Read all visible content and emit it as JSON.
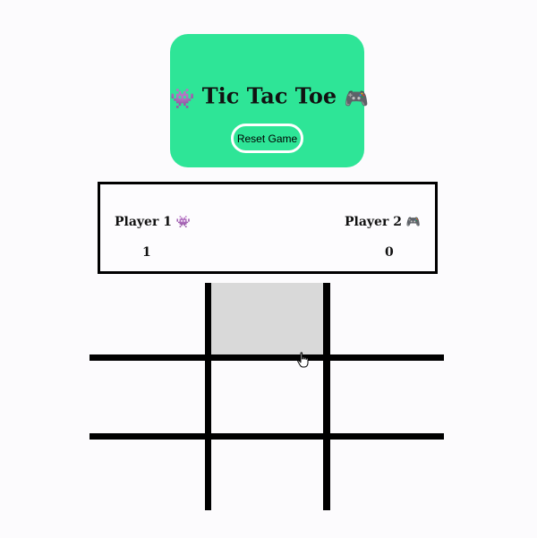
{
  "header": {
    "title": "Tic Tac Toe",
    "title_left_icon": "alien-monster-icon",
    "title_right_icon": "game-controller-icon",
    "reset_label": "Reset Game",
    "card_color": "#2ee597"
  },
  "scoreboard": {
    "player1": {
      "label": "Player 1",
      "icon": "alien-monster-icon",
      "score": "1"
    },
    "player2": {
      "label": "Player 2",
      "icon": "game-controller-icon",
      "score": "0"
    }
  },
  "board": {
    "cells": [
      "",
      "",
      "",
      "",
      "",
      "",
      "",
      "",
      ""
    ],
    "hovered_cell": 1,
    "hover_color": "#d9d9d9"
  }
}
